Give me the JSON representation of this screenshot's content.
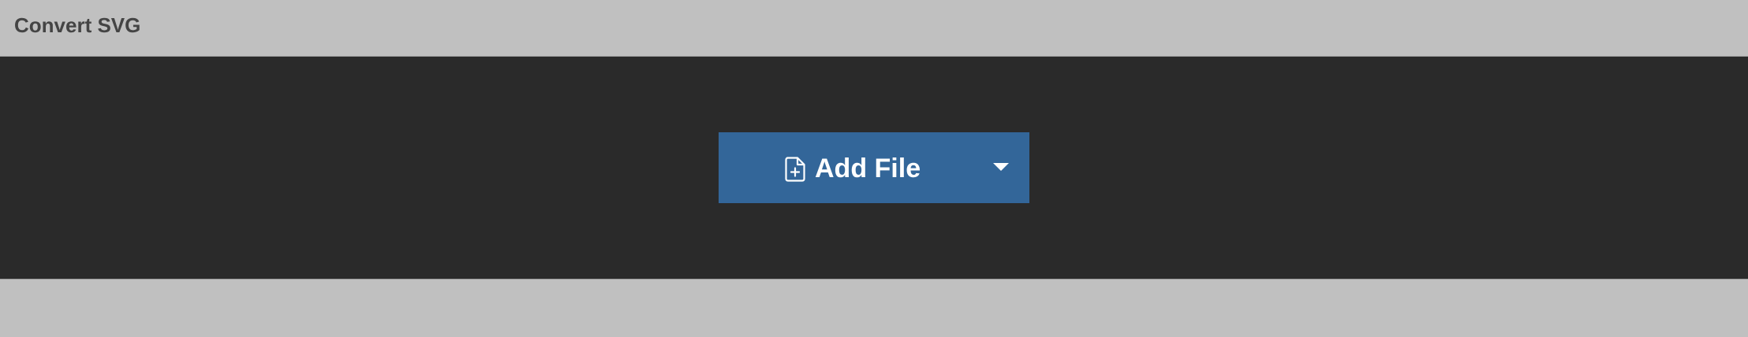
{
  "header": {
    "title": "Convert SVG"
  },
  "add_file_button": {
    "label": "Add File",
    "icon": "file-plus-icon",
    "dropdown_icon": "caret-down-icon"
  },
  "colors": {
    "header_bg": "#c0c0c0",
    "title_text": "#444444",
    "dropzone_bg": "#2a2a2a",
    "button_bg": "#336699",
    "button_text": "#ffffff"
  }
}
